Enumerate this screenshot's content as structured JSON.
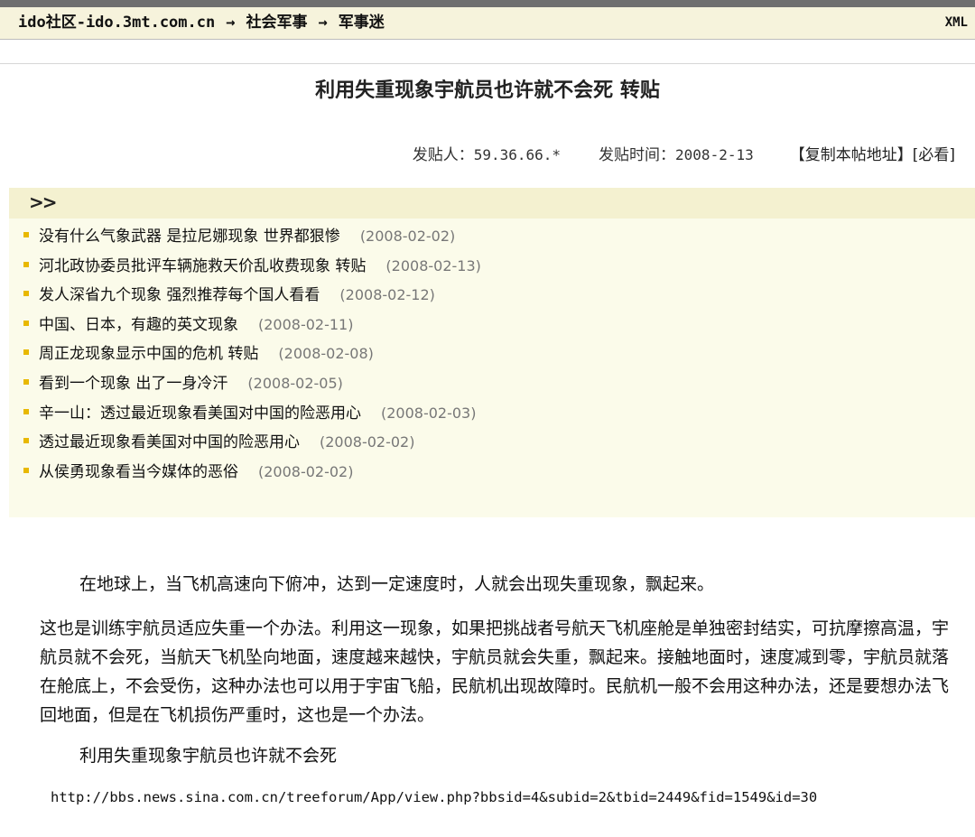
{
  "breadcrumb": {
    "site": "ido社区-ido.3mt.com.cn",
    "section": "社会军事",
    "subsection": "军事迷",
    "separator": "→"
  },
  "header": {
    "xml_label": "XML"
  },
  "post": {
    "title": "利用失重现象宇航员也许就不会死 转贴",
    "author_label": "发贴人：",
    "author": "59.36.66.*",
    "time_label": "发贴时间：",
    "time": "2008-2-13",
    "copy_link_label": "【复制本帖地址】",
    "must_read_label": "[必看]"
  },
  "related": {
    "header_arrows": ">>",
    "items": [
      {
        "title": "没有什么气象武器 是拉尼娜现象 世界都狠惨",
        "date": "(2008-02-02)"
      },
      {
        "title": "河北政协委员批评车辆施救天价乱收费现象 转贴",
        "date": "(2008-02-13)"
      },
      {
        "title": "发人深省九个现象 强烈推荐每个国人看看",
        "date": "(2008-02-12)"
      },
      {
        "title": "中国、日本，有趣的英文现象",
        "date": "(2008-02-11)"
      },
      {
        "title": "周正龙现象显示中国的危机 转贴",
        "date": "(2008-02-08)"
      },
      {
        "title": "看到一个现象 出了一身冷汗",
        "date": "(2008-02-05)"
      },
      {
        "title": "辛一山：透过最近现象看美国对中国的险恶用心",
        "date": "(2008-02-03)"
      },
      {
        "title": "透过最近现象看美国对中国的险恶用心",
        "date": "(2008-02-02)"
      },
      {
        "title": "从侯勇现象看当今媒体的恶俗",
        "date": "(2008-02-02)"
      }
    ]
  },
  "content": {
    "paragraph1": "在地球上，当飞机高速向下俯冲，达到一定速度时，人就会出现失重现象，飘起来。",
    "paragraph2": "这也是训练宇航员适应失重一个办法。利用这一现象，如果把挑战者号航天飞机座舱是单独密封结实，可抗摩擦高温，宇航员就不会死，当航天飞机坠向地面，速度越来越快，宇航员就会失重，飘起来。接触地面时，速度减到零，宇航员就落在舱底上，不会受伤，这种办法也可以用于宇宙飞船，民航机出现故障时。民航机一般不会用这种办法，还是要想办法飞回地面，但是在飞机损伤严重时，这也是一个办法。",
    "paragraph3": "利用失重现象宇航员也许就不会死",
    "source_url": "http://bbs.news.sina.com.cn/treeforum/App/view.php?bbsid=4&subid=2&tbid=2449&fid=1549&id=30"
  },
  "colors": {
    "breadcrumb_bg": "#f6f3dc",
    "related_bg": "#fbfbea",
    "related_header_bg": "#f4f1d0",
    "bullet": "#e8b800",
    "date_text": "#777777"
  }
}
